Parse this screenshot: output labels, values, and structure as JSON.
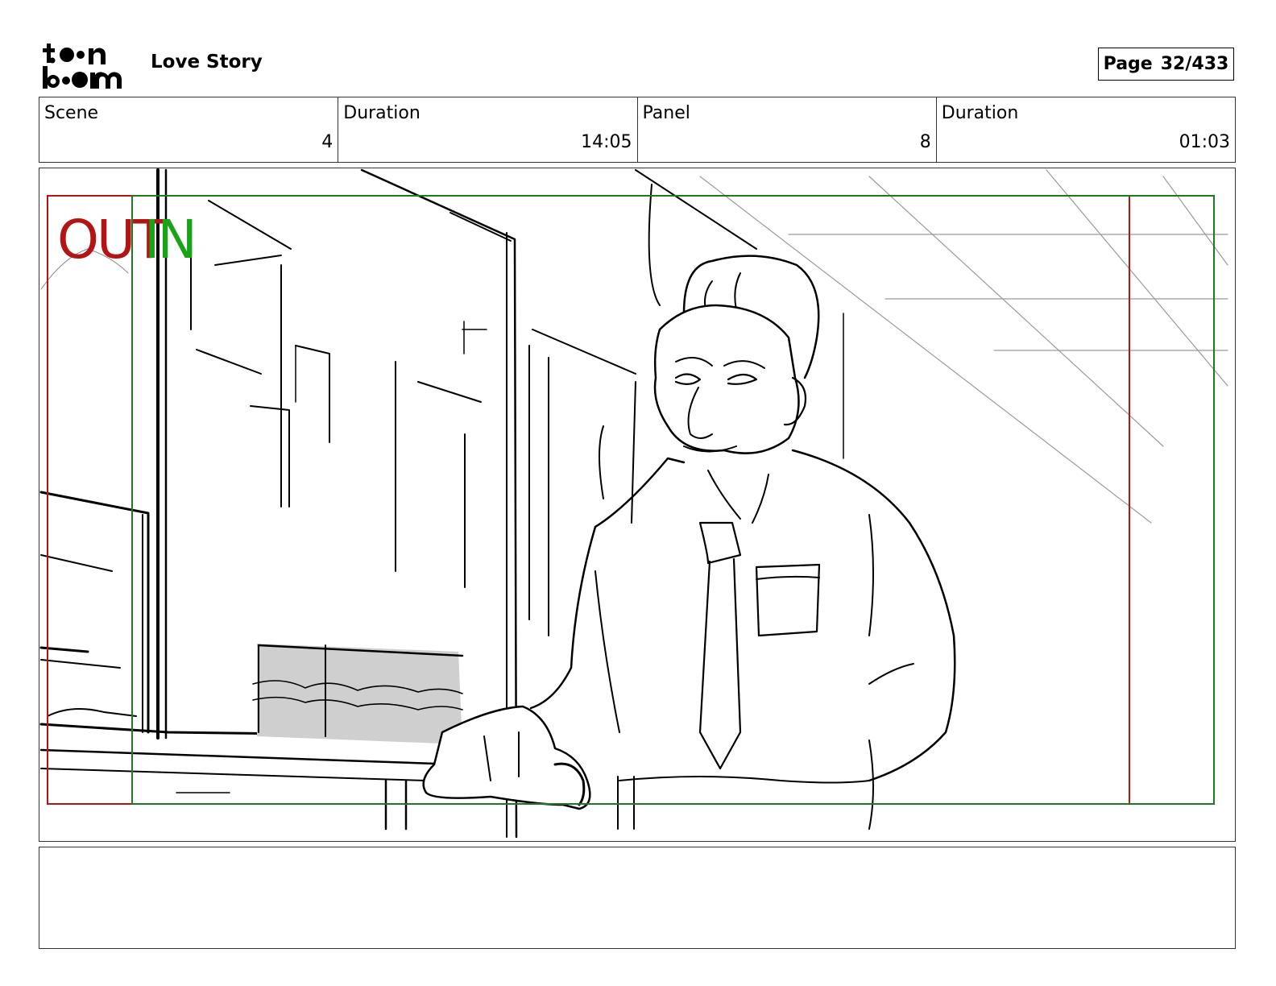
{
  "header": {
    "logo_text": "toon boom",
    "project_title": "Love Story",
    "page_label": "Page",
    "page_number": "32/433"
  },
  "info": {
    "scene_label": "Scene",
    "scene_value": "4",
    "scene_duration_label": "Duration",
    "scene_duration_value": "14:05",
    "panel_label": "Panel",
    "panel_value": "8",
    "panel_duration_label": "Duration",
    "panel_duration_value": "01:03"
  },
  "panel": {
    "out_marker": "OUT",
    "in_marker": "IN",
    "colors": {
      "out_frame": "#b31414",
      "in_frame": "#1e7a1e"
    }
  },
  "notes": {
    "text": ""
  }
}
